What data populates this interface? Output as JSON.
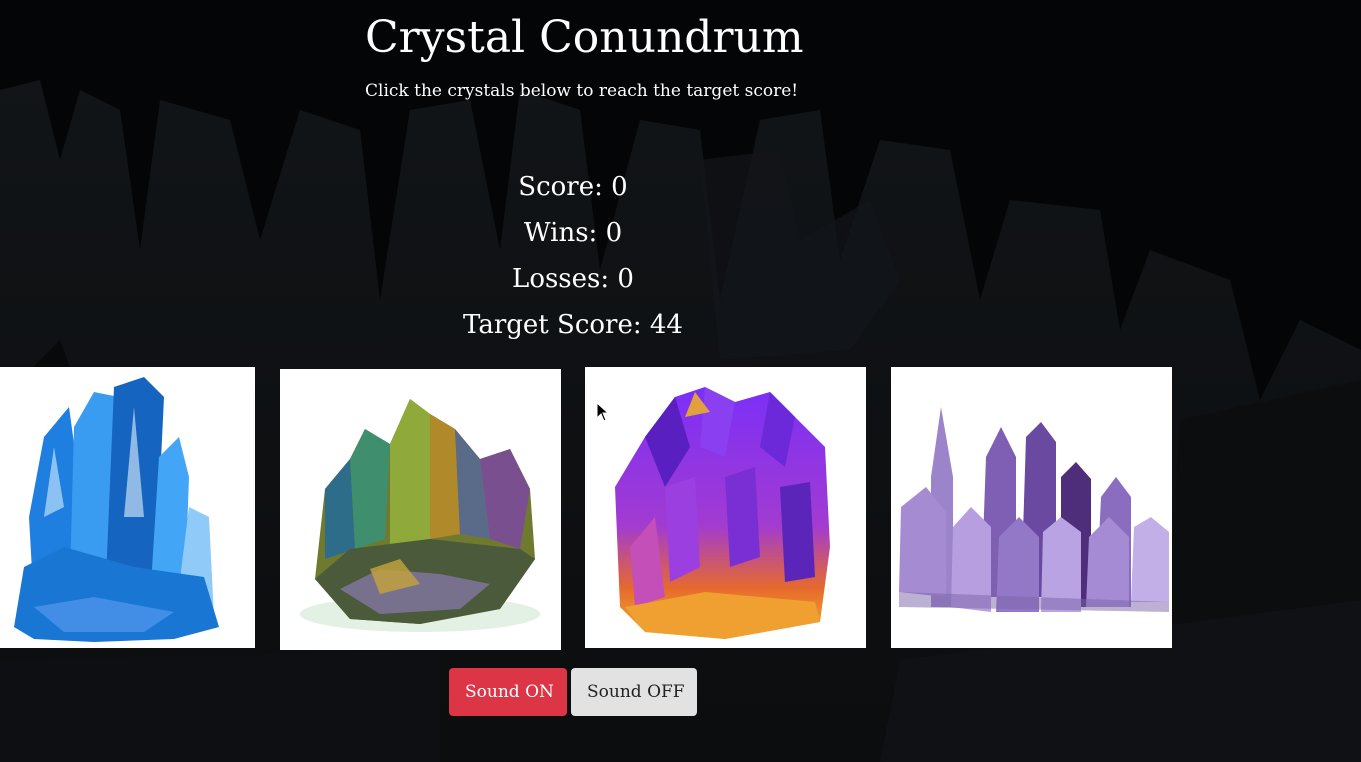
{
  "game": {
    "title": "Crystal Conundrum",
    "instructions": "Click the crystals below to reach the target score!"
  },
  "stats": {
    "score": "Score: 0",
    "wins": "Wins: 0",
    "losses": "Losses: 0",
    "target": "Target Score: 44"
  },
  "crystals": [
    {
      "name": "blue-crystal",
      "color": "#1e88e5"
    },
    {
      "name": "rainbow-crystal",
      "color": "#7a8a2a"
    },
    {
      "name": "purple-gold-crystal",
      "color": "#8a2be2"
    },
    {
      "name": "amethyst-crystal",
      "color": "#9a7cc8"
    }
  ],
  "sound": {
    "on_label": "Sound ON",
    "off_label": "Sound OFF",
    "on_color": "#dc3545",
    "off_color": "#e2e2e2"
  }
}
